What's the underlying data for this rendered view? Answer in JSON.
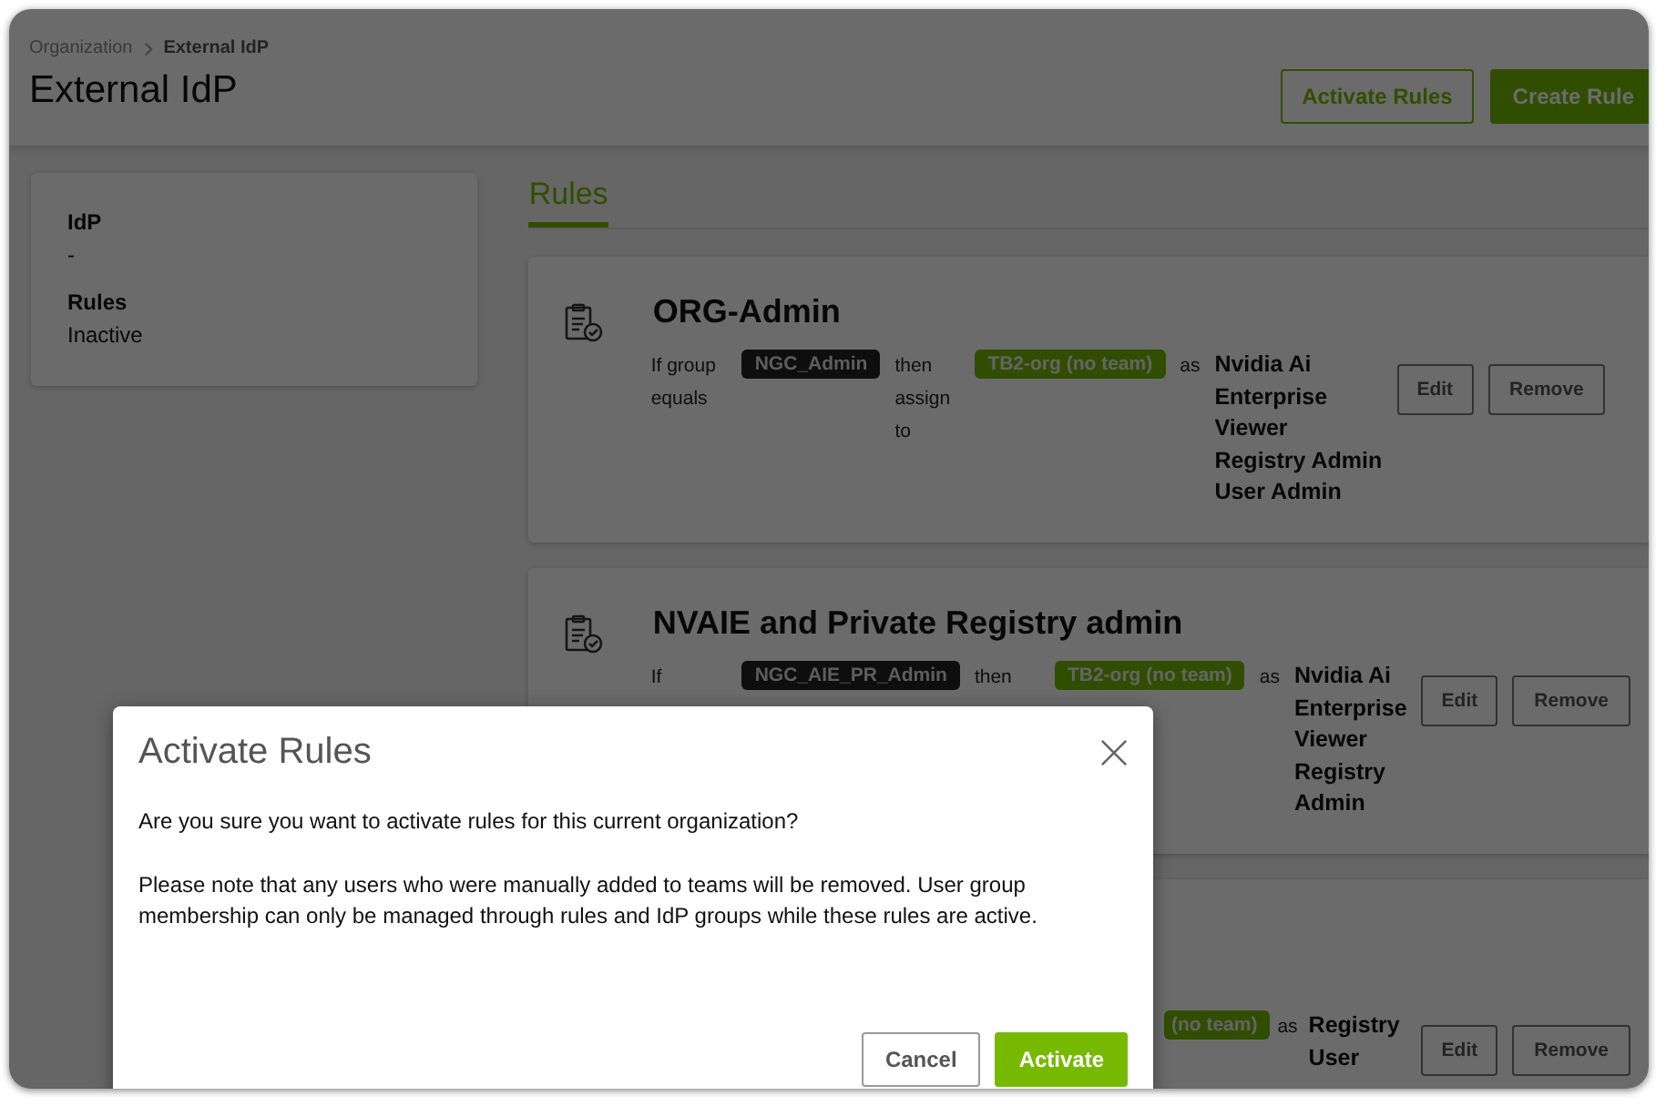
{
  "breadcrumb": [
    {
      "label": "Organization"
    },
    {
      "label": "External IdP"
    }
  ],
  "page_title": "External IdP",
  "header_buttons": [
    {
      "label": "Activate Rules",
      "kind": "outline"
    },
    {
      "label": "Create Rule",
      "kind": "primary"
    }
  ],
  "summary": [
    {
      "label": "IdP",
      "value": "-"
    },
    {
      "label": "Rules",
      "value": "Inactive"
    }
  ],
  "tabs": [
    {
      "label": "Rules",
      "selected": true
    }
  ],
  "rules": [
    {
      "title": "ORG-Admin",
      "condition": "If group equals",
      "group": "NGC_Admin",
      "connector": "then assign to",
      "team": "TB2-org (no team)",
      "as": "as",
      "roles": [
        "Nvidia Ai Enterprise Viewer",
        "Registry Admin",
        "User Admin"
      ],
      "actions": [
        "Edit",
        "Remove"
      ]
    },
    {
      "title": "NVAIE and Private Registry admin",
      "condition": "If",
      "group": "NGC_AIE_PR_Admin",
      "connector": "then",
      "team": "TB2-org (no team)",
      "as": "as",
      "roles": [
        "Nvidia Ai Enterprise Viewer",
        "Registry Admin"
      ],
      "actions": [
        "Edit",
        "Remove"
      ]
    },
    {
      "team": "(no team)",
      "as": "as",
      "roles": [
        "Registry User"
      ],
      "actions": [
        "Edit",
        "Remove"
      ]
    }
  ],
  "dialog": {
    "title": "Activate Rules",
    "paragraphs": [
      "Are you sure you want to activate rules for this current organization?",
      "Please note that any users who were manually added to teams will be removed. User group membership can only be managed through rules and IdP groups while these rules are active."
    ],
    "buttons": [
      {
        "label": "Cancel",
        "kind": "outline"
      },
      {
        "label": "Activate",
        "kind": "primary"
      }
    ]
  }
}
